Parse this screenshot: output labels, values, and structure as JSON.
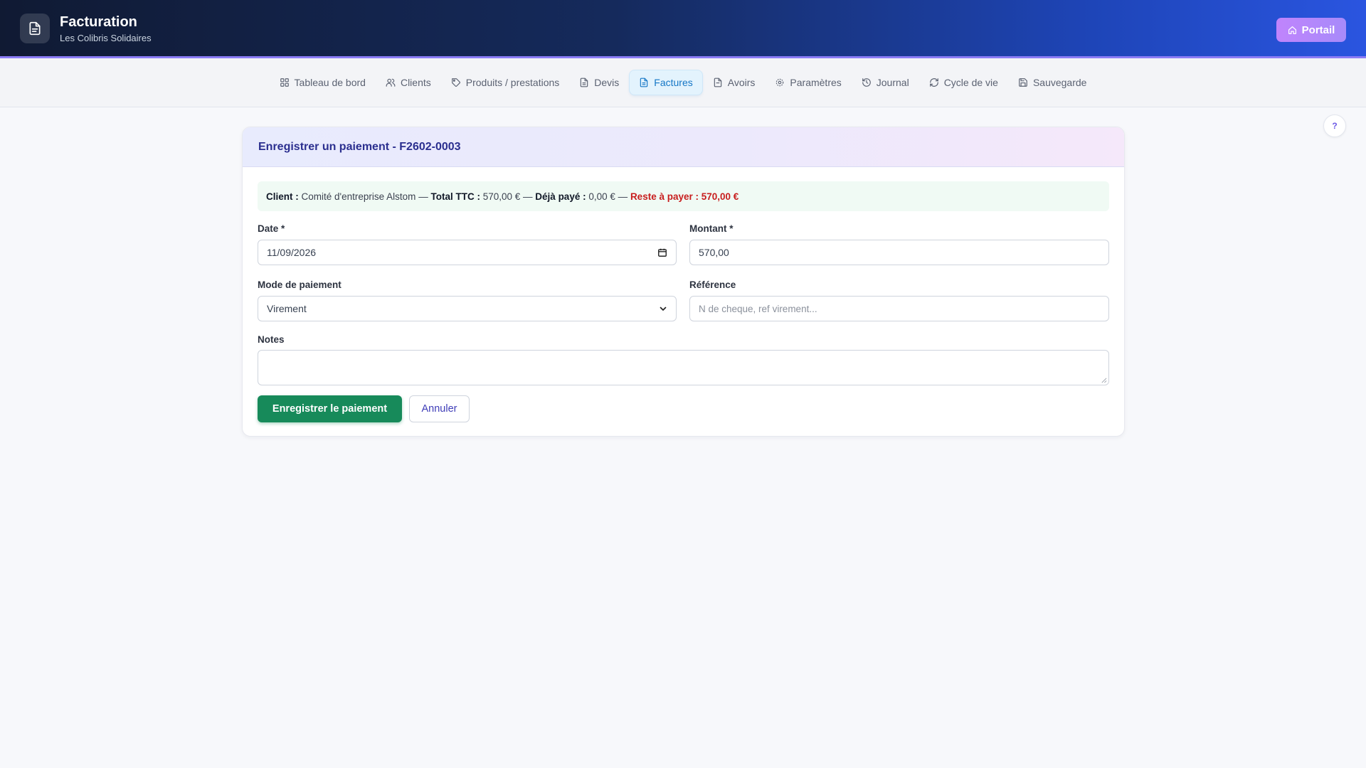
{
  "header": {
    "title": "Facturation",
    "subtitle": "Les Colibris Solidaires",
    "portal_label": "Portail"
  },
  "nav": {
    "items": [
      {
        "label": "Tableau de bord",
        "icon": "grid-icon"
      },
      {
        "label": "Clients",
        "icon": "users-icon"
      },
      {
        "label": "Produits / prestations",
        "icon": "tag-icon"
      },
      {
        "label": "Devis",
        "icon": "file-icon"
      },
      {
        "label": "Factures",
        "icon": "file-text-icon",
        "active": true
      },
      {
        "label": "Avoirs",
        "icon": "file-icon"
      },
      {
        "label": "Paramètres",
        "icon": "gear-icon"
      },
      {
        "label": "Journal",
        "icon": "history-icon"
      },
      {
        "label": "Cycle de vie",
        "icon": "refresh-icon"
      },
      {
        "label": "Sauvegarde",
        "icon": "save-icon"
      }
    ]
  },
  "help": {
    "label": "?"
  },
  "form": {
    "title": "Enregistrer un paiement - F2602-0003",
    "summary": {
      "client_label": "Client :",
      "client_value": "Comité d'entreprise Alstom",
      "sep1": "—",
      "total_label": "Total TTC :",
      "total_value": "570,00 €",
      "sep2": "—",
      "paid_label": "Déjà payé :",
      "paid_value": "0,00 €",
      "sep3": "—",
      "remaining": "Reste à payer : 570,00 €"
    },
    "date": {
      "label": "Date *",
      "value": "11/09/2026"
    },
    "amount": {
      "label": "Montant *",
      "value": "570,00"
    },
    "payment_mode": {
      "label": "Mode de paiement",
      "value": "Virement"
    },
    "reference": {
      "label": "Référence",
      "placeholder": "N de cheque, ref virement..."
    },
    "notes": {
      "label": "Notes",
      "value": ""
    },
    "submit_label": "Enregistrer le paiement",
    "cancel_label": "Annuler"
  },
  "colors": {
    "accent": "#178a5a",
    "active_nav": "#1577c6",
    "due": "#c81e1e",
    "title": "#2b2f8f"
  }
}
